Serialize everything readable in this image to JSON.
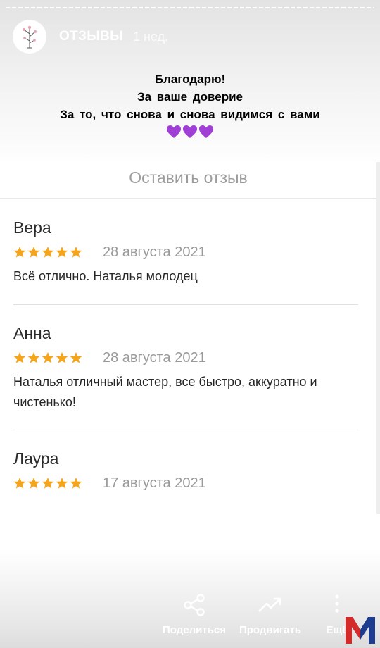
{
  "story": {
    "title": "ОТЗЫВЫ",
    "time": "1 нед.",
    "caption_lines": [
      "Благодарю!",
      "За ваше доверие",
      "За то, что снова и снова видимся с вами"
    ],
    "heart_icons": [
      "purple-heart-icon",
      "purple-heart-icon",
      "purple-heart-icon"
    ]
  },
  "reviews_card": {
    "leave_review_label": "Оставить отзыв",
    "reviews": [
      {
        "name": "Вера",
        "rating": 5,
        "date": "28 августа 2021",
        "text": "Всё отлично. Наталья молодец"
      },
      {
        "name": "Анна",
        "rating": 5,
        "date": "28 августа 2021",
        "text": "Наталья отличный мастер, все быстро, аккуратно и чистенько!"
      },
      {
        "name": "Лаура",
        "rating": 5,
        "date": "17 августа 2021",
        "text": ""
      }
    ]
  },
  "actions": {
    "share_label": "Поделиться",
    "promote_label": "Продвигать",
    "more_label": "Ещё"
  },
  "colors": {
    "star": "#f4a51c",
    "heart": "#a03fd6",
    "logo_red": "#d42a2a",
    "logo_blue": "#1f3d8f"
  }
}
